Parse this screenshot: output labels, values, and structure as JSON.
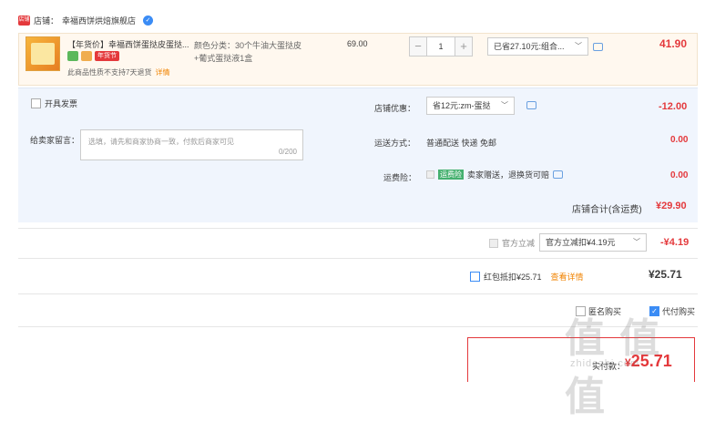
{
  "shop": {
    "logo": "店铺",
    "label": "店铺：",
    "name": "幸福西饼烘焙旗舰店",
    "badge_icon": "verified-icon"
  },
  "item": {
    "title": "【年货价】幸福西饼蛋挞皮蛋挞...",
    "tag_new_year": "年货节",
    "note": "此商品性质不支持7天退货",
    "note_link": "详情",
    "sku_line1": "颜色分类：30个牛油大蛋挞皮",
    "sku_line2": "+葡式蛋挞液1盒",
    "price": "69.00",
    "qty_minus": "−",
    "qty": "1",
    "qty_plus": "+",
    "discount_select": "已省27.10元:组合...",
    "line_total": "41.90"
  },
  "panel": {
    "invoice_label": "开具发票",
    "message_label": "给卖家留言：",
    "message_placeholder": "选填，请先和商家协商一致，付款后商家可见",
    "message_count": "0/200",
    "coupon_label": "店铺优惠：",
    "coupon_select": "省12元:zm-蛋挞",
    "coupon_amount": "-12.00",
    "shipping_label": "运送方式：",
    "shipping_value": "普通配送 快递 免邮",
    "shipping_amount": "0.00",
    "insurance_label": "运费险：",
    "insurance_tag": "运费险",
    "insurance_value": "卖家赠送，退换货可赔",
    "insurance_amount": "0.00",
    "shop_total_label": "店铺合计(含运费)",
    "shop_total": "¥29.90"
  },
  "platform": {
    "label": "官方立减",
    "select": "官方立减扣¥4.19元",
    "amount": "-¥4.19"
  },
  "redpack": {
    "label": "红包抵扣¥25.71",
    "link": "查看详情",
    "amount": "¥25.71"
  },
  "options": {
    "anonymous": "匿名购买",
    "instead": "代付购买"
  },
  "pay": {
    "label": "实付款：",
    "yen": "¥",
    "amount": "25.71"
  },
  "watermark": {
    "big": "值 值 值",
    "small": "zhidezhi.com"
  },
  "colors": {
    "accent": "#e4393c",
    "panel": "#f0f5fd",
    "item_bg": "#fff8ef",
    "link": "#f08300"
  }
}
